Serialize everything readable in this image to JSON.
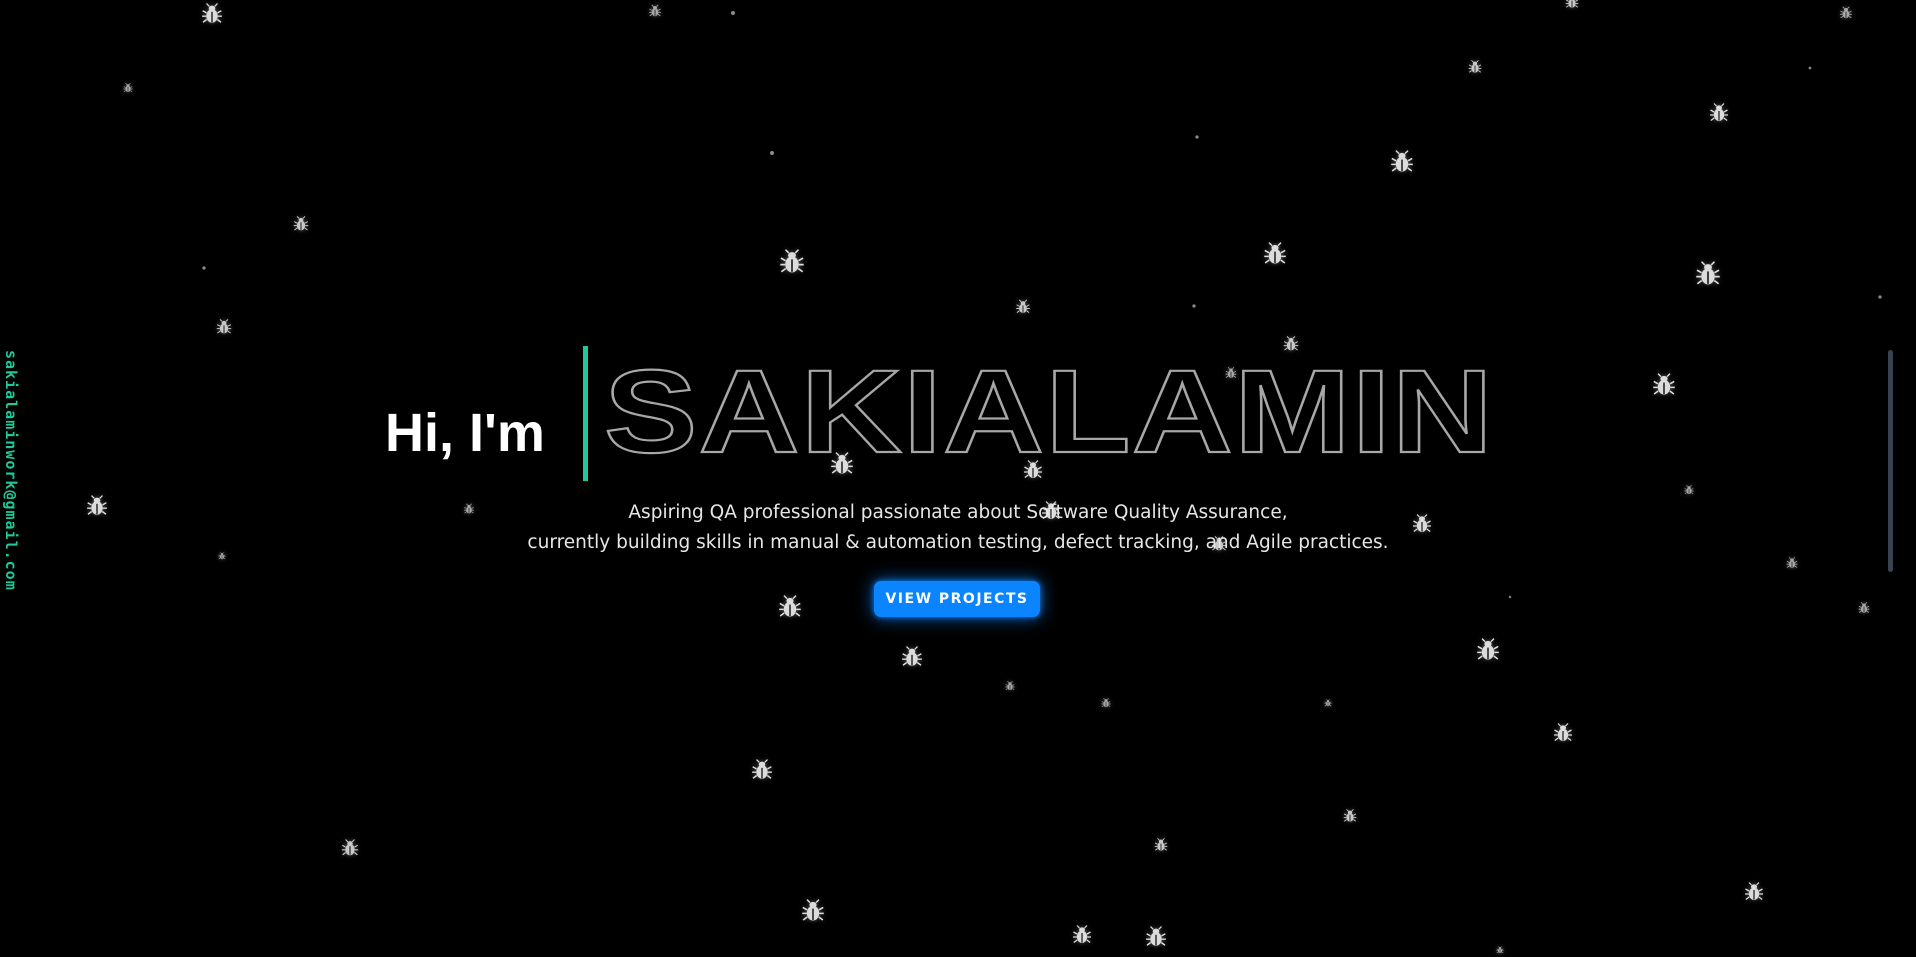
{
  "contact": {
    "email": "sakialaminwork@gmail.com"
  },
  "hero": {
    "greeting": "Hi, I'm",
    "name": "SAKIALAMIN",
    "tagline_line1": "Aspiring QA professional passionate about Software Quality Assurance,",
    "tagline_line2": "currently building skills in manual & automation testing, defect tracking, and Agile practices.",
    "cta_label": "VIEW PROJECTS"
  },
  "theme": {
    "background": "#000000",
    "accent": "#1ec99a",
    "button": "#0a84ff",
    "outline_text": "#a7a7a7"
  },
  "decor": {
    "particle_icon": "bug-icon"
  }
}
